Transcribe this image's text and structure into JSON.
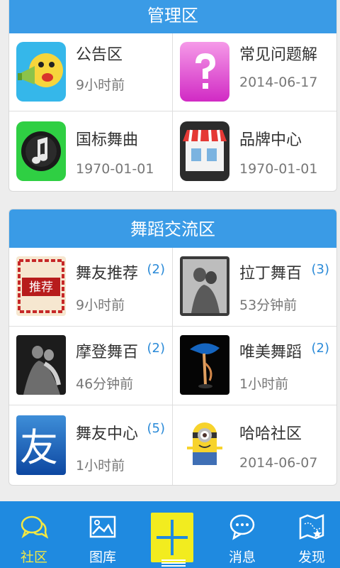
{
  "sections": [
    {
      "title": "管理区",
      "items": [
        {
          "title": "公告区",
          "sub": "9小时前",
          "badge": "",
          "icon": "megaphone-icon"
        },
        {
          "title": "常见问题解",
          "sub": "2014-06-17",
          "badge": "",
          "icon": "question-icon"
        },
        {
          "title": "国标舞曲",
          "sub": "1970-01-01",
          "badge": "",
          "icon": "music-note-icon"
        },
        {
          "title": "品牌中心",
          "sub": "1970-01-01",
          "badge": "",
          "icon": "storefront-icon"
        }
      ]
    },
    {
      "title": "舞蹈交流区",
      "items": [
        {
          "title": "舞友推荐",
          "sub": "9小时前",
          "badge": "(2)",
          "icon": "recommend-icon",
          "icon_text": "推荐"
        },
        {
          "title": "拉丁舞百",
          "sub": "53分钟前",
          "badge": "(3)",
          "icon": "latin-dance-photo"
        },
        {
          "title": "摩登舞百",
          "sub": "46分钟前",
          "badge": "(2)",
          "icon": "modern-dance-photo"
        },
        {
          "title": "唯美舞蹈",
          "sub": "1小时前",
          "badge": "(2)",
          "icon": "aesthetic-dance-photo"
        },
        {
          "title": "舞友中心",
          "sub": "1小时前",
          "badge": "(5)",
          "icon": "friend-center-icon",
          "icon_text": "友"
        },
        {
          "title": "哈哈社区",
          "sub": "2014-06-07",
          "badge": "",
          "icon": "minion-icon"
        }
      ]
    }
  ],
  "tabbar": {
    "items": [
      {
        "label": "社区",
        "icon": "chat-bubbles-icon",
        "active": true
      },
      {
        "label": "图库",
        "icon": "image-icon",
        "active": false
      },
      {
        "label": "消息",
        "icon": "message-icon",
        "active": false
      },
      {
        "label": "发现",
        "icon": "map-icon",
        "active": false
      }
    ],
    "center_button_icon": "plus-icon"
  },
  "colors": {
    "accent": "#3a9be6",
    "tabbar": "#1f8ae0",
    "active_tab": "#f3e843",
    "plus_button": "#f2ec1f",
    "badge": "#2a8ad8"
  }
}
